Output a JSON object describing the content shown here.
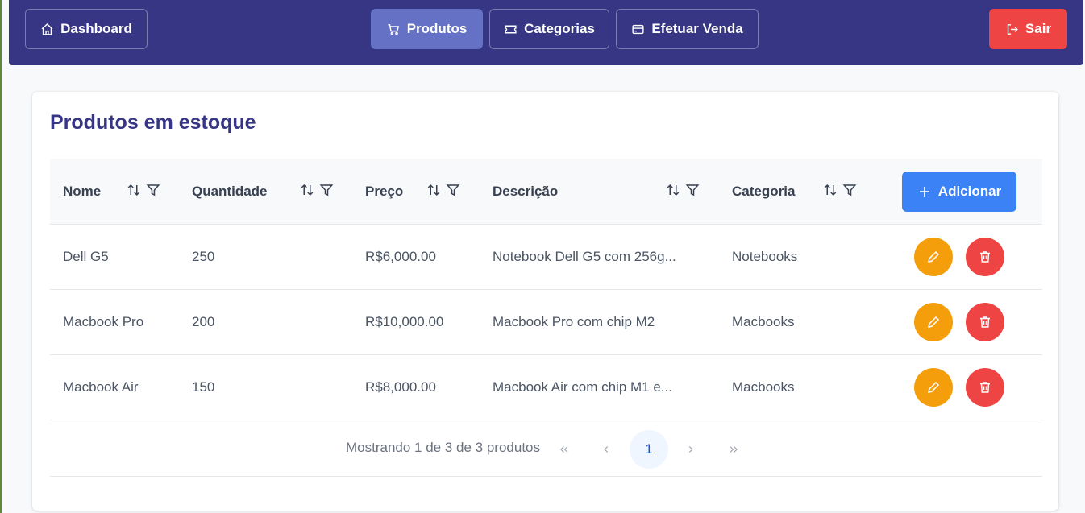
{
  "navbar": {
    "dashboard_label": "Dashboard",
    "produtos_label": "Produtos",
    "categorias_label": "Categorias",
    "efetuar_venda_label": "Efetuar Venda",
    "sair_label": "Sair"
  },
  "page": {
    "title": "Produtos em estoque"
  },
  "table": {
    "columns": [
      "Nome",
      "Quantidade",
      "Preço",
      "Descrição",
      "Categoria"
    ],
    "add_label": "Adicionar",
    "rows": [
      {
        "nome": "Dell G5",
        "quantidade": "250",
        "preco": "R$6,000.00",
        "descricao": "Notebook Dell G5 com 256g...",
        "categoria": "Notebooks"
      },
      {
        "nome": "Macbook Pro",
        "quantidade": "200",
        "preco": "R$10,000.00",
        "descricao": "Macbook Pro com chip M2",
        "categoria": "Macbooks"
      },
      {
        "nome": "Macbook Air",
        "quantidade": "150",
        "preco": "R$8,000.00",
        "descricao": "Macbook Air com chip M1 e...",
        "categoria": "Macbooks"
      }
    ]
  },
  "pagination": {
    "summary": "Mostrando 1 de 3 de 3 produtos",
    "current_page": "1"
  },
  "colors": {
    "navbar": "#363684",
    "active_nav": "#6571c4",
    "danger": "#ef4444",
    "warning": "#f59e0b",
    "primary": "#3b82f6"
  }
}
